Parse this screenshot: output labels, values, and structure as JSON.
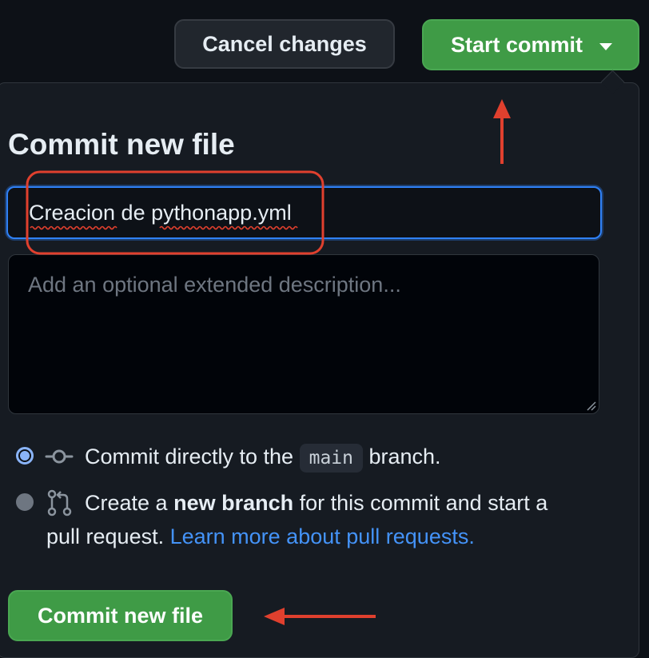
{
  "header": {
    "cancel_label": "Cancel changes",
    "start_commit_label": "Start commit"
  },
  "commit": {
    "title": "Commit new file",
    "summary_value": "Creacion de pythonapp.yml",
    "description_placeholder": "Add an optional extended description...",
    "option_direct": {
      "prefix": "Commit directly to the",
      "branch": "main",
      "suffix": "branch.",
      "selected": true
    },
    "option_new_branch": {
      "prefix": "Create a",
      "bold": "new branch",
      "suffix_line1": "for this commit and start a",
      "line2_text": "pull request.",
      "link_text": "Learn more about pull requests.",
      "selected": false
    },
    "submit_label": "Commit new file"
  },
  "colors": {
    "background": "#0d1117",
    "panel": "#161b22",
    "primary_button": "#3f9b46",
    "focus_border": "#2f81f7",
    "link": "#4493f8",
    "annotation": "#e0402e"
  }
}
